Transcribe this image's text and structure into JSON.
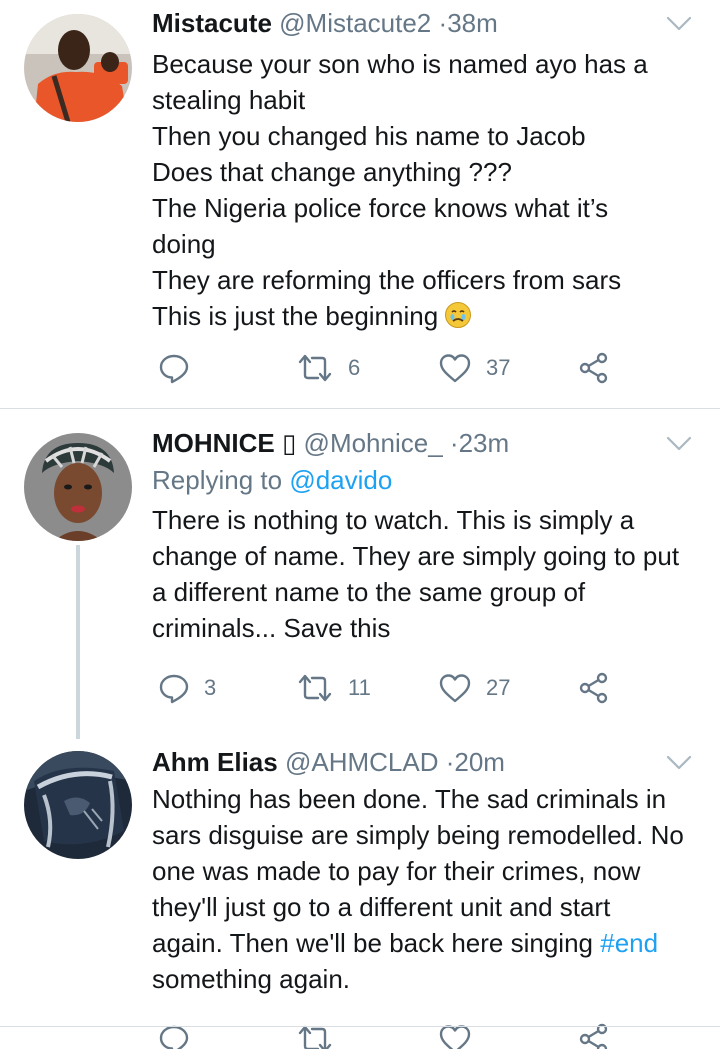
{
  "tweets": [
    {
      "name": "Mistacute",
      "handle": "@Mistacute2",
      "separator": "·",
      "time": "38m",
      "lines": [
        "Because your son who is named ayo has a",
        "stealing habit",
        "Then you changed his name to Jacob",
        "Does that change anything ???",
        "The Nigeria police force knows what it’s",
        "doing",
        "They are reforming the officers from sars",
        "This is just the beginning"
      ],
      "emoji": "crying-face-emoji",
      "reply_count": "",
      "retweet_count": "6",
      "like_count": "37"
    },
    {
      "name": "MOHNICE ▯",
      "handle": "@Mohnice_",
      "separator": "·",
      "time": "23m",
      "replying_to_prefix": "Replying to",
      "replying_to_handle": "@davido",
      "lines": [
        "There is nothing to watch. This is simply a",
        "change of name. They are simply going to put",
        "a different name to the same group of",
        "criminals... Save this"
      ],
      "reply_count": "3",
      "retweet_count": "11",
      "like_count": "27"
    },
    {
      "name": "Ahm Elias",
      "handle": "@AHMCLAD",
      "separator": "·",
      "time": "20m",
      "lines": [
        "Nothing has been done. The sad criminals in",
        "sars disguise are simply being remodelled. No",
        "one was made to pay for their crimes, now",
        "they'll just go to a different unit and start",
        "again. Then we'll be back here singing"
      ],
      "hashtag": "#end",
      "last_line": "something again."
    }
  ],
  "colors": {
    "text": "#14171a",
    "secondary": "#657786",
    "link": "#1da1f2",
    "divider": "#d9dee3"
  }
}
